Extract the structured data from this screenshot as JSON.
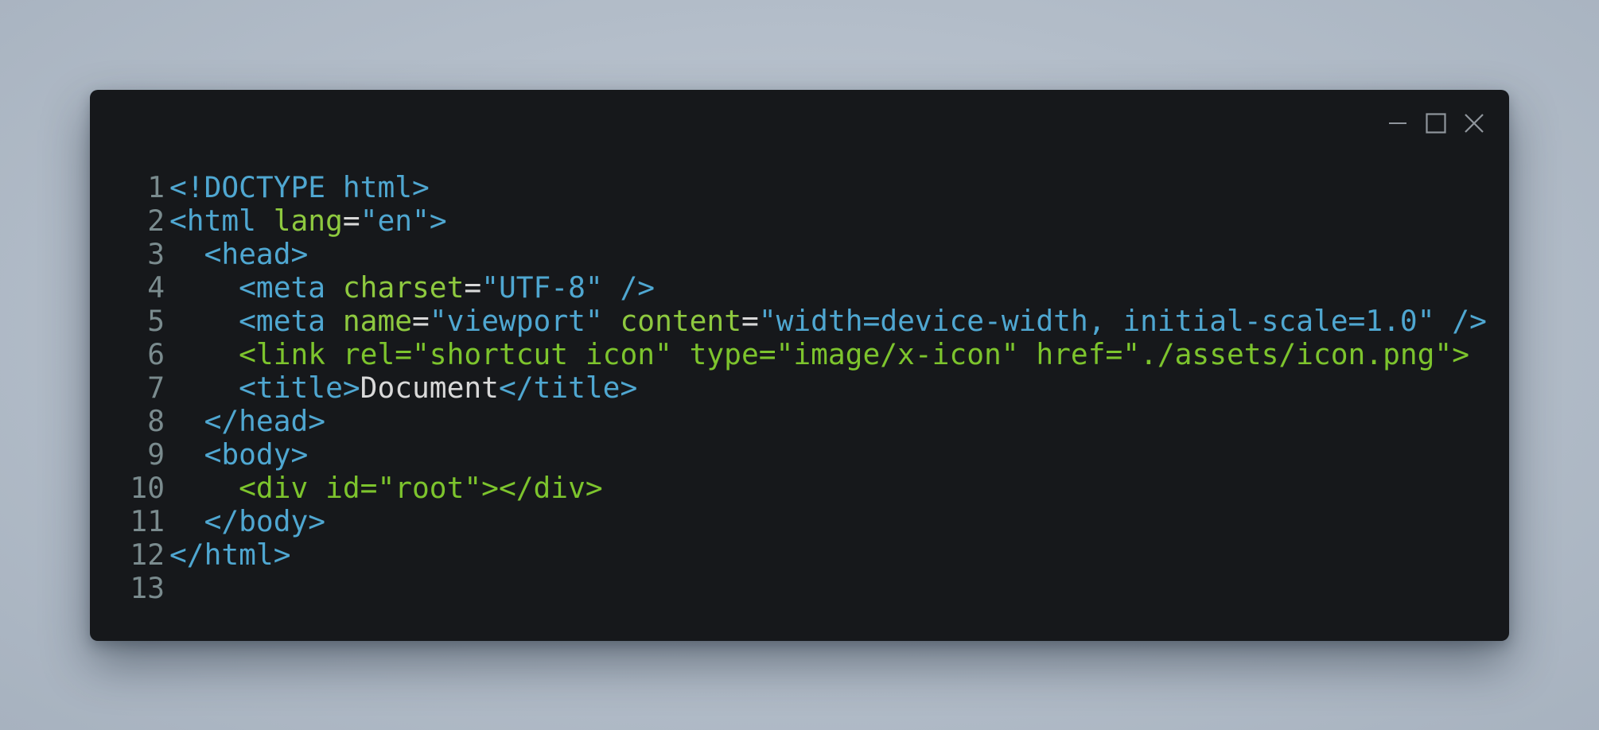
{
  "window_controls": {
    "minimize": "minimize-icon",
    "maximize": "maximize-icon",
    "close": "close-icon"
  },
  "colors": {
    "background": "#aeb8c4",
    "editor_background": "#16181b",
    "line_number": "#7a8b8e",
    "tag": "#4fa7d1",
    "attribute": "#8ec93f",
    "string": "#4fa7d1",
    "text": "#d9d9d9",
    "link_line": "#7dc42d"
  },
  "editor": {
    "lines": [
      {
        "num": "1",
        "tokens": [
          {
            "t": "<!DOCTYPE html>",
            "c": "tag"
          }
        ]
      },
      {
        "num": "2",
        "tokens": [
          {
            "t": "<html ",
            "c": "tag"
          },
          {
            "t": "lang",
            "c": "attr"
          },
          {
            "t": "=",
            "c": "eq"
          },
          {
            "t": "\"en\"",
            "c": "str"
          },
          {
            "t": ">",
            "c": "tag"
          }
        ]
      },
      {
        "num": "3",
        "tokens": [
          {
            "t": "  <head>",
            "c": "tag"
          }
        ]
      },
      {
        "num": "4",
        "tokens": [
          {
            "t": "    <meta ",
            "c": "tag"
          },
          {
            "t": "charset",
            "c": "attr"
          },
          {
            "t": "=",
            "c": "eq"
          },
          {
            "t": "\"UTF-8\"",
            "c": "str"
          },
          {
            "t": " />",
            "c": "tag"
          }
        ]
      },
      {
        "num": "5",
        "tokens": [
          {
            "t": "    <meta ",
            "c": "tag"
          },
          {
            "t": "name",
            "c": "attr"
          },
          {
            "t": "=",
            "c": "eq"
          },
          {
            "t": "\"viewport\"",
            "c": "str"
          },
          {
            "t": " ",
            "c": "tag"
          },
          {
            "t": "content",
            "c": "attr"
          },
          {
            "t": "=",
            "c": "eq"
          },
          {
            "t": "\"width=device-width, initial-scale=1.0\"",
            "c": "str"
          },
          {
            "t": " />",
            "c": "tag"
          }
        ]
      },
      {
        "num": "6",
        "tokens": [
          {
            "t": "    <link rel=\"shortcut icon\" type=\"image/x-icon\" href=\"./assets/icon.png\">",
            "c": "green"
          }
        ]
      },
      {
        "num": "7",
        "tokens": [
          {
            "t": "    <title>",
            "c": "tag"
          },
          {
            "t": "Document",
            "c": "text"
          },
          {
            "t": "</title>",
            "c": "tag"
          }
        ]
      },
      {
        "num": "8",
        "tokens": [
          {
            "t": "  </head>",
            "c": "tag"
          }
        ]
      },
      {
        "num": "9",
        "tokens": [
          {
            "t": "  <body>",
            "c": "tag"
          }
        ]
      },
      {
        "num": "10",
        "tokens": [
          {
            "t": "    <div id=\"root\"></div>",
            "c": "green"
          }
        ]
      },
      {
        "num": "11",
        "tokens": [
          {
            "t": "  </body>",
            "c": "tag"
          }
        ]
      },
      {
        "num": "12",
        "tokens": [
          {
            "t": "</html>",
            "c": "tag"
          }
        ]
      },
      {
        "num": "13",
        "tokens": []
      }
    ]
  }
}
